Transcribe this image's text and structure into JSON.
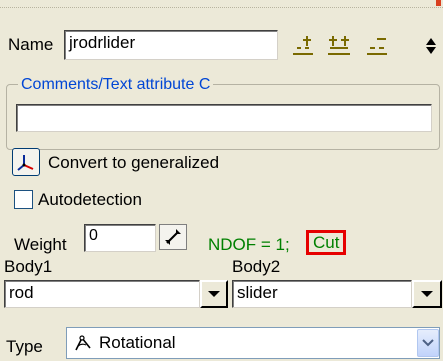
{
  "name_label": "Name",
  "name_value": "jrodrlider",
  "comments_caption": "Comments/Text attribute C",
  "comments_value": "",
  "convert_label": "Convert to generalized",
  "autodetection_label": "Autodetection",
  "weight_label": "Weight",
  "weight_value": "0",
  "ndof_text": "NDOF = 1;",
  "cut_text": "Cut",
  "body1_label": "Body1",
  "body1_value": "rod",
  "body2_label": "Body2",
  "body2_value": "slider",
  "type_label": "Type",
  "type_value": "Rotational",
  "colors": {
    "caption_blue": "#0046d5",
    "ndof_green": "#008000",
    "cut_highlight_red": "#e60000",
    "icon_olive": "#7a6a00"
  }
}
